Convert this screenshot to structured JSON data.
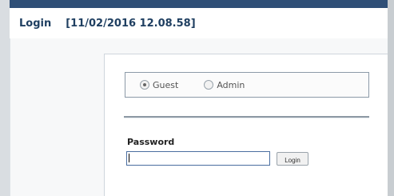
{
  "header": {
    "title": "Login",
    "timestamp": "[11/02/2016 12.08.58]"
  },
  "role_selector": {
    "options": [
      {
        "label": "Guest",
        "checked": true
      },
      {
        "label": "Admin",
        "checked": false
      }
    ]
  },
  "password": {
    "label": "Password",
    "value": ""
  },
  "login_button": {
    "label": "Login"
  }
}
